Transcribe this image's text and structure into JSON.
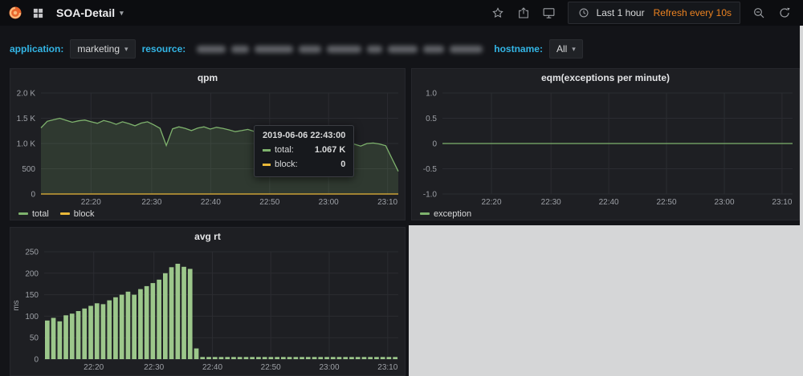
{
  "navbar": {
    "title": "SOA-Detail",
    "time_range": "Last 1 hour",
    "refresh_interval": "Refresh every 10s"
  },
  "filters": {
    "application_label": "application:",
    "application_value": "marketing",
    "resource_label": "resource:",
    "resource_value_redacted": true,
    "hostname_label": "hostname:",
    "hostname_value": "All"
  },
  "colors": {
    "accent_orange": "#eb8220",
    "filter_label_cyan": "#33b5e5",
    "series_green": "#7EB26D",
    "series_yellow": "#EAB839",
    "bar_green": "#9CC78B",
    "panel_bg": "#1e1f23",
    "page_bg": "#131418"
  },
  "chart_data": [
    {
      "type": "area",
      "title": "qpm",
      "ylabel": "",
      "ylim": [
        0,
        2000
      ],
      "ytick_values": [
        2000,
        1500,
        1000,
        500,
        0
      ],
      "ytick_labels": [
        "2.0 K",
        "1.5 K",
        "1.0 K",
        "500",
        "0"
      ],
      "xtick_labels": [
        "22:20",
        "22:30",
        "22:40",
        "22:50",
        "23:00",
        "23:10"
      ],
      "xtick_pos": [
        0.14,
        0.31,
        0.475,
        0.64,
        0.805,
        0.97
      ],
      "grid_color": "#2b2c31",
      "legend_position": "bottom-left",
      "series": [
        {
          "name": "total",
          "color": "#7EB26D",
          "fill": true,
          "values": [
            1310,
            1440,
            1470,
            1500,
            1460,
            1420,
            1450,
            1465,
            1430,
            1400,
            1455,
            1425,
            1380,
            1430,
            1395,
            1350,
            1405,
            1430,
            1370,
            1300,
            960,
            1290,
            1330,
            1300,
            1255,
            1305,
            1330,
            1285,
            1320,
            1300,
            1270,
            1235,
            1255,
            1280,
            1240,
            1205,
            1230,
            1250,
            1205,
            1185,
            1205,
            1155,
            1105,
            1067,
            1050,
            985,
            905,
            950,
            1000,
            1020,
            985,
            950,
            1000,
            1010,
            990,
            955,
            700,
            450
          ]
        },
        {
          "name": "block",
          "color": "#EAB839",
          "fill": false,
          "values": [
            0,
            0
          ]
        }
      ],
      "tooltip": {
        "time": "2019-06-06 22:43:00",
        "rows": [
          {
            "label": "total:",
            "value": "1.067 K",
            "color": "#7EB26D"
          },
          {
            "label": "block:",
            "value": "0",
            "color": "#EAB839"
          }
        ]
      }
    },
    {
      "type": "line",
      "title": "eqm(exceptions per minute)",
      "ylabel": "",
      "ylim": [
        -1,
        1
      ],
      "ytick_values": [
        1,
        0.5,
        0,
        -0.5,
        -1
      ],
      "ytick_labels": [
        "1.0",
        "0.5",
        "0",
        "-0.5",
        "-1.0"
      ],
      "xtick_labels": [
        "22:20",
        "22:30",
        "22:40",
        "22:50",
        "23:00",
        "23:10"
      ],
      "xtick_pos": [
        0.14,
        0.31,
        0.475,
        0.64,
        0.805,
        0.97
      ],
      "grid_color": "#2b2c31",
      "legend_position": "bottom-left",
      "series": [
        {
          "name": "exception",
          "color": "#7EB26D",
          "fill": false,
          "values": [
            0,
            0
          ]
        }
      ]
    },
    {
      "type": "bar",
      "title": "avg rt",
      "ylabel": "ms",
      "ylim": [
        0,
        250
      ],
      "ytick_values": [
        250,
        200,
        150,
        100,
        50,
        0
      ],
      "ytick_labels": [
        "250",
        "200",
        "150",
        "100",
        "50",
        "0"
      ],
      "xtick_labels": [
        "22:20",
        "22:30",
        "22:40",
        "22:50",
        "23:00",
        "23:10"
      ],
      "xtick_pos": [
        0.14,
        0.31,
        0.475,
        0.64,
        0.805,
        0.97
      ],
      "grid_color": "#2b2c31",
      "series": [
        {
          "name": "",
          "color": "#9CC78B",
          "fill": true,
          "values": [
            90,
            96,
            88,
            102,
            106,
            112,
            118,
            124,
            130,
            128,
            137,
            144,
            150,
            157,
            150,
            163,
            170,
            177,
            185,
            200,
            214,
            222,
            215,
            210,
            25,
            5,
            5,
            5,
            5,
            5,
            5,
            5,
            5,
            5,
            5,
            5,
            5,
            5,
            5,
            5,
            5,
            5,
            5,
            5,
            5,
            5,
            5,
            5,
            5,
            5,
            5,
            5,
            5,
            5,
            5,
            5,
            5
          ]
        }
      ]
    }
  ]
}
